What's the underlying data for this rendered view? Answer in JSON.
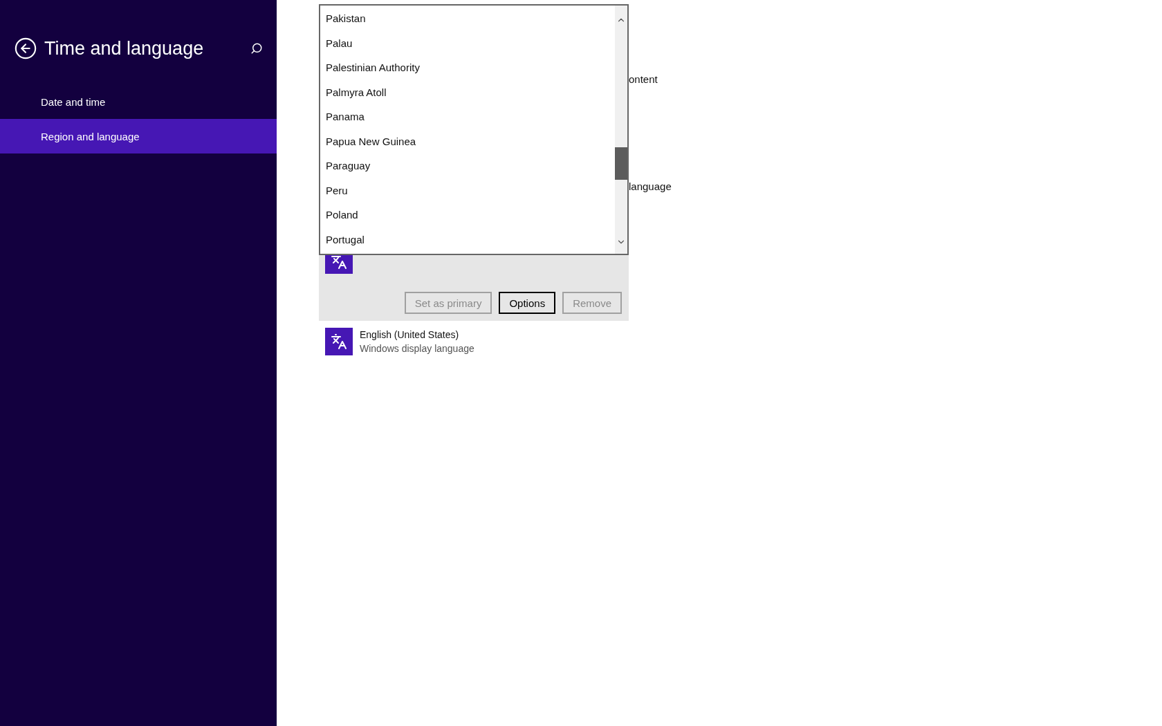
{
  "sidebar": {
    "title": "Time and language",
    "items": [
      {
        "label": "Date and time",
        "selected": false
      },
      {
        "label": "Region and language",
        "selected": true
      }
    ]
  },
  "background_texts": [
    "ontent",
    "language"
  ],
  "country_dropdown": {
    "items": [
      "Pakistan",
      "Palau",
      "Palestinian Authority",
      "Palmyra Atoll",
      "Panama",
      "Papua New Guinea",
      "Paraguay",
      "Peru",
      "Poland",
      "Portugal"
    ]
  },
  "language_list": [
    {
      "kind": "expanded",
      "buttons": [
        {
          "label": "Set as primary",
          "disabled": true
        },
        {
          "label": "Options",
          "disabled": false
        },
        {
          "label": "Remove",
          "disabled": true
        }
      ]
    },
    {
      "kind": "plain",
      "name": "English (United States)",
      "detail": "Windows display language"
    }
  ]
}
